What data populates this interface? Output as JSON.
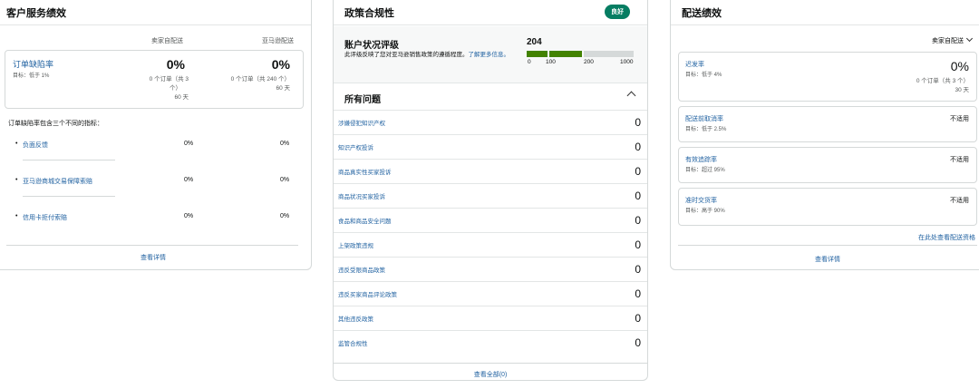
{
  "customer_service": {
    "title": "客户服务绩效",
    "col_merchant": "卖家自配送",
    "col_amazon": "亚马逊配送",
    "odr": {
      "title": "订单缺陷率",
      "target": "目标：低于 1%",
      "merchant_pct": "0%",
      "merchant_sub1": "0 个订单（共 3",
      "merchant_sub2": "个）",
      "merchant_days": "60 天",
      "amazon_pct": "0%",
      "amazon_sub": "0 个订单（共 240 个）",
      "amazon_days": "60 天"
    },
    "desc": "订单缺陷率包含三个不同的指标：",
    "metrics": [
      {
        "name": "负面反馈",
        "merchant": "0%",
        "amazon": "0%"
      },
      {
        "name": "亚马逊商城交易保障索赔",
        "merchant": "0%",
        "amazon": "0%"
      },
      {
        "name": "信用卡拒付索赔",
        "merchant": "0%",
        "amazon": "0%"
      }
    ],
    "bullet": "•",
    "details_link": "查看详情"
  },
  "policy": {
    "title": "政策合规性",
    "badge": "良好",
    "ahr_title": "账户状况评级",
    "ahr_desc": "此评级反映了您对亚马逊销售政策的遵循程度。",
    "ahr_link": "了解更多信息。",
    "score": "204",
    "ticks": [
      "0",
      "100",
      "200",
      "1000"
    ],
    "colors": {
      "good": "#428200",
      "empty": "#d5d9d9"
    },
    "issues_title": "所有问题",
    "issues": [
      {
        "name": "涉嫌侵犯知识产权",
        "count": "0"
      },
      {
        "name": "知识产权投诉",
        "count": "0"
      },
      {
        "name": "商品真实性买家投诉",
        "count": "0"
      },
      {
        "name": "商品状况买家投诉",
        "count": "0"
      },
      {
        "name": "食品和商品安全问题",
        "count": "0"
      },
      {
        "name": "上架政策违规",
        "count": "0"
      },
      {
        "name": "违反受限商品政策",
        "count": "0"
      },
      {
        "name": "违反买家商品评论政策",
        "count": "0"
      },
      {
        "name": "其他违反政策",
        "count": "0"
      },
      {
        "name": "监管合规性",
        "count": "0"
      }
    ],
    "view_all": "查看全部(0)"
  },
  "shipping": {
    "title": "配送绩效",
    "filter": "卖家自配送",
    "late": {
      "title": "迟发率",
      "target": "目标：低于 4%",
      "pct": "0%",
      "sub": "0 个订单（共 3 个）",
      "days": "30 天"
    },
    "precancel": {
      "title": "配送前取消率",
      "target": "目标：低于 2.5%",
      "value": "不适用"
    },
    "tracking": {
      "title": "有效追踪率",
      "target": "目标：超过 95%",
      "value": "不适用"
    },
    "ontime": {
      "title": "准时交货率",
      "target": "目标：高于 90%",
      "value": "不适用"
    },
    "eligibility_link": "在此处查看配送资格",
    "details_link": "查看详情"
  }
}
